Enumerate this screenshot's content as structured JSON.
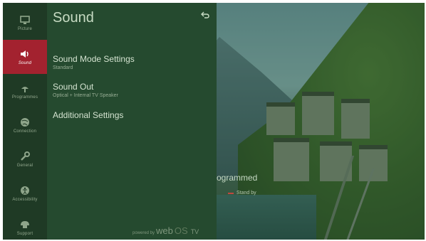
{
  "sidebar": {
    "items": [
      {
        "label": "Picture",
        "icon": "picture-icon",
        "active": false
      },
      {
        "label": "Sound",
        "icon": "speaker-icon",
        "active": true
      },
      {
        "label": "Programmes",
        "icon": "antenna-icon",
        "active": false
      },
      {
        "label": "Connection",
        "icon": "globe-icon",
        "active": false
      },
      {
        "label": "General",
        "icon": "wrench-icon",
        "active": false
      },
      {
        "label": "Accessibility",
        "icon": "accessibility-icon",
        "active": false
      },
      {
        "label": "Support",
        "icon": "support-icon",
        "active": false
      }
    ]
  },
  "panel": {
    "title": "Sound",
    "back_icon": "back-icon",
    "items": [
      {
        "label": "Sound Mode Settings",
        "sub": "Standard"
      },
      {
        "label": "Sound Out",
        "sub": "Optical + Internal TV Speaker"
      },
      {
        "label": "Additional Settings",
        "sub": ""
      }
    ],
    "footer": {
      "powered_by": "powered by",
      "brand_web": "web",
      "brand_os": "OS",
      "brand_tv": "TV"
    }
  },
  "background": {
    "label": "ogrammed",
    "sub": "Stand by"
  },
  "colors": {
    "accent": "#a3222f",
    "overlay": "#254a2f"
  }
}
